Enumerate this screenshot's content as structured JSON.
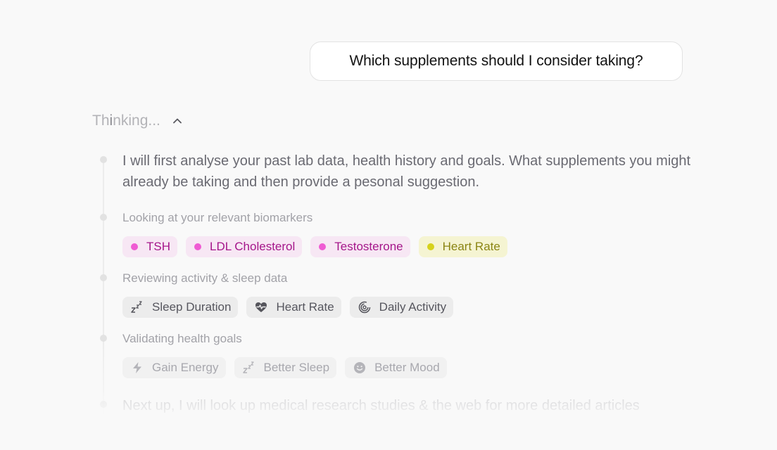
{
  "user_message": "Which supplements should I consider taking?",
  "thinking": {
    "label_dark": "Th",
    "label_highlight": "i",
    "label_rest": "nking...",
    "chevron": "chevron-up-icon"
  },
  "intro_paragraph": "I will first analyse your past lab data, health history and goals. What supplements you might already be taking and then provide a pesonal suggestion.",
  "steps": [
    {
      "label": "Looking at your relevant biomarkers",
      "chips": [
        {
          "label": "TSH",
          "color": "#ef5bd3"
        },
        {
          "label": "LDL Cholesterol",
          "color": "#ef5bd3"
        },
        {
          "label": "Testosterone",
          "color": "#ef5bd3"
        },
        {
          "label": "Heart Rate",
          "color": "#d6d21c"
        }
      ]
    },
    {
      "label": "Reviewing activity & sleep data",
      "chips": [
        {
          "label": "Sleep Duration",
          "icon": "sleep-zzz-icon"
        },
        {
          "label": "Heart Rate",
          "icon": "heart-pulse-icon"
        },
        {
          "label": "Daily Activity",
          "icon": "activity-rings-icon"
        }
      ]
    },
    {
      "label": "Validating health goals",
      "chips": [
        {
          "label": "Gain Energy",
          "icon": "lightning-icon"
        },
        {
          "label": "Better Sleep",
          "icon": "sleep-zzz-icon"
        },
        {
          "label": "Better Mood",
          "icon": "smiley-icon"
        }
      ]
    }
  ],
  "next_paragraph": "Next up, I will look up medical research studies & the web for more detailed articles"
}
